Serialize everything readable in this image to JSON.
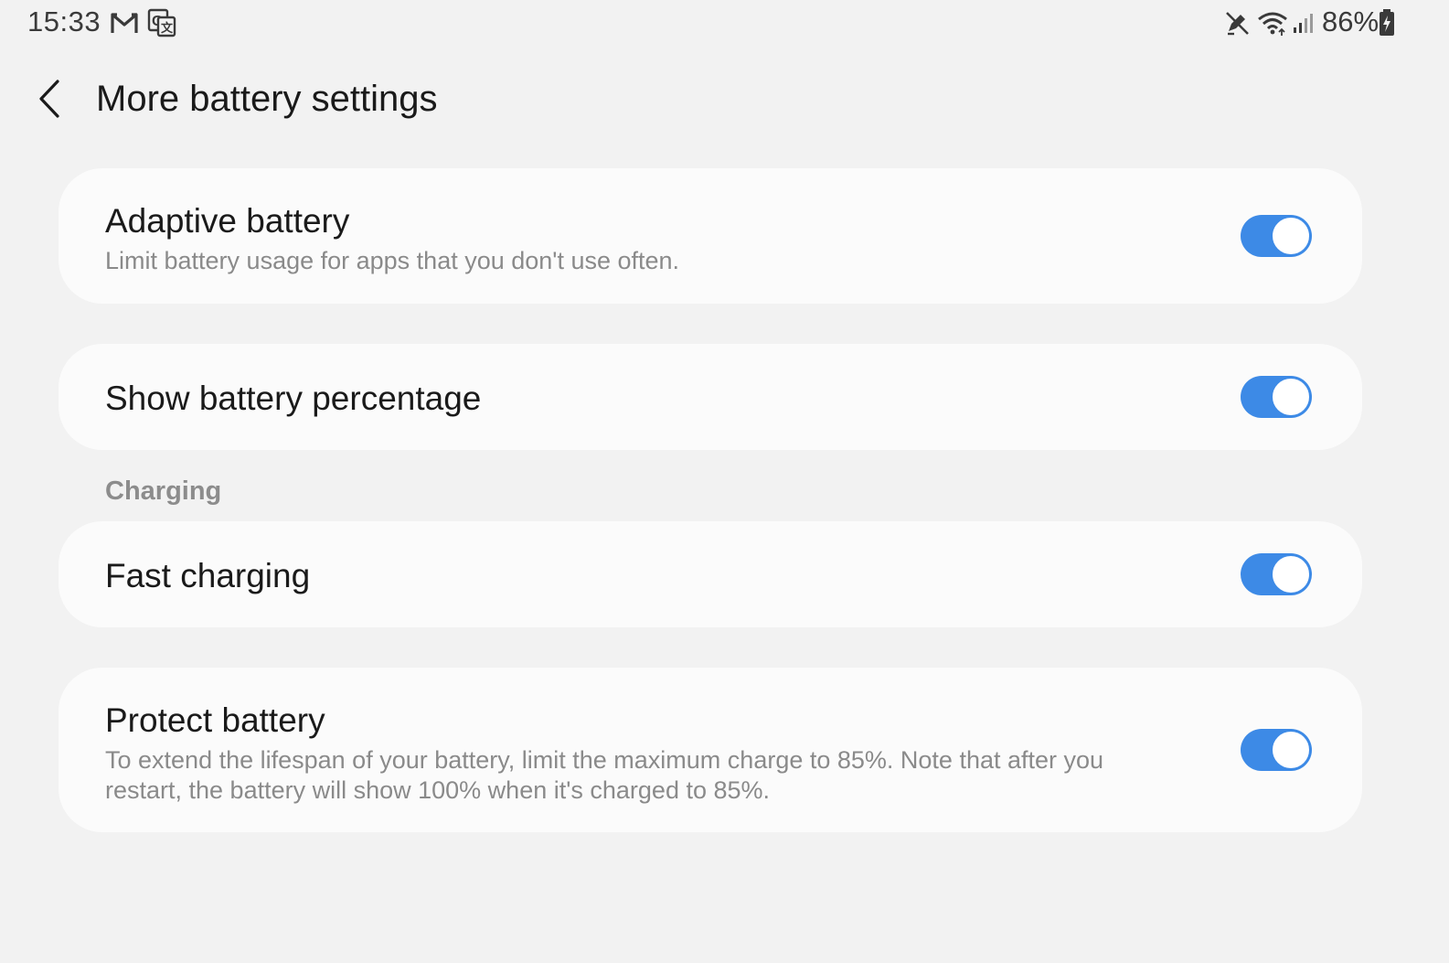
{
  "status_bar": {
    "time": "15:33",
    "battery_percent": "86%",
    "icons": [
      "gmail-icon",
      "translate-icon",
      "pen-off-icon",
      "wifi-icon",
      "signal-icon",
      "battery-charging-icon"
    ]
  },
  "header": {
    "back_icon": "chevron-left-icon",
    "title": "More battery settings"
  },
  "settings": [
    {
      "title": "Adaptive battery",
      "subtitle": "Limit battery usage for apps that you don't use often.",
      "enabled": true
    },
    {
      "title": "Show battery percentage",
      "enabled": true
    }
  ],
  "charging_section": {
    "header": "Charging",
    "items": [
      {
        "title": "Fast charging",
        "enabled": true
      },
      {
        "title": "Protect battery",
        "subtitle_line1": "To extend the lifespan of your battery, limit the maximum charge to 85%. Note that after you",
        "subtitle_line2": "restart, the battery will show 100% when it's charged to 85%.",
        "enabled": true
      }
    ]
  },
  "colors": {
    "background": "#f2f2f2",
    "card": "#fbfbfb",
    "accent": "#3d8ae6",
    "secondary_text": "#8a8a8a"
  }
}
